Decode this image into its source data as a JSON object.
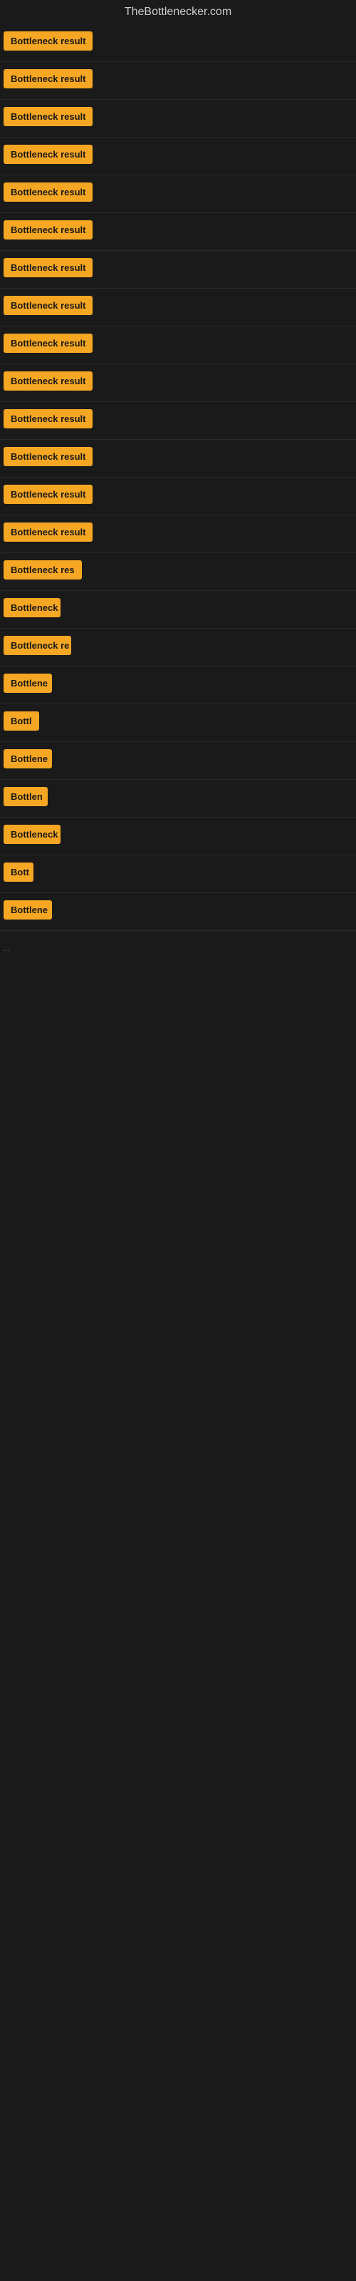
{
  "site": {
    "title": "TheBottlenecker.com"
  },
  "results": [
    {
      "id": 1,
      "label": "Bottleneck result",
      "width": 130
    },
    {
      "id": 2,
      "label": "Bottleneck result",
      "width": 130
    },
    {
      "id": 3,
      "label": "Bottleneck result",
      "width": 130
    },
    {
      "id": 4,
      "label": "Bottleneck result",
      "width": 130
    },
    {
      "id": 5,
      "label": "Bottleneck result",
      "width": 130
    },
    {
      "id": 6,
      "label": "Bottleneck result",
      "width": 130
    },
    {
      "id": 7,
      "label": "Bottleneck result",
      "width": 130
    },
    {
      "id": 8,
      "label": "Bottleneck result",
      "width": 130
    },
    {
      "id": 9,
      "label": "Bottleneck result",
      "width": 130
    },
    {
      "id": 10,
      "label": "Bottleneck result",
      "width": 130
    },
    {
      "id": 11,
      "label": "Bottleneck result",
      "width": 130
    },
    {
      "id": 12,
      "label": "Bottleneck result",
      "width": 130
    },
    {
      "id": 13,
      "label": "Bottleneck result",
      "width": 130
    },
    {
      "id": 14,
      "label": "Bottleneck result",
      "width": 130
    },
    {
      "id": 15,
      "label": "Bottleneck res",
      "width": 112
    },
    {
      "id": 16,
      "label": "Bottleneck",
      "width": 80
    },
    {
      "id": 17,
      "label": "Bottleneck re",
      "width": 95
    },
    {
      "id": 18,
      "label": "Bottlene",
      "width": 68
    },
    {
      "id": 19,
      "label": "Bottl",
      "width": 50
    },
    {
      "id": 20,
      "label": "Bottlene",
      "width": 68
    },
    {
      "id": 21,
      "label": "Bottlen",
      "width": 62
    },
    {
      "id": 22,
      "label": "Bottleneck",
      "width": 80
    },
    {
      "id": 23,
      "label": "Bott",
      "width": 42
    },
    {
      "id": 24,
      "label": "Bottlene",
      "width": 68
    }
  ],
  "indicator": {
    "dots": "..."
  },
  "colors": {
    "badge_bg": "#f5a623",
    "badge_text": "#1a1a1a",
    "site_title": "#cccccc",
    "background": "#1a1a1a"
  }
}
